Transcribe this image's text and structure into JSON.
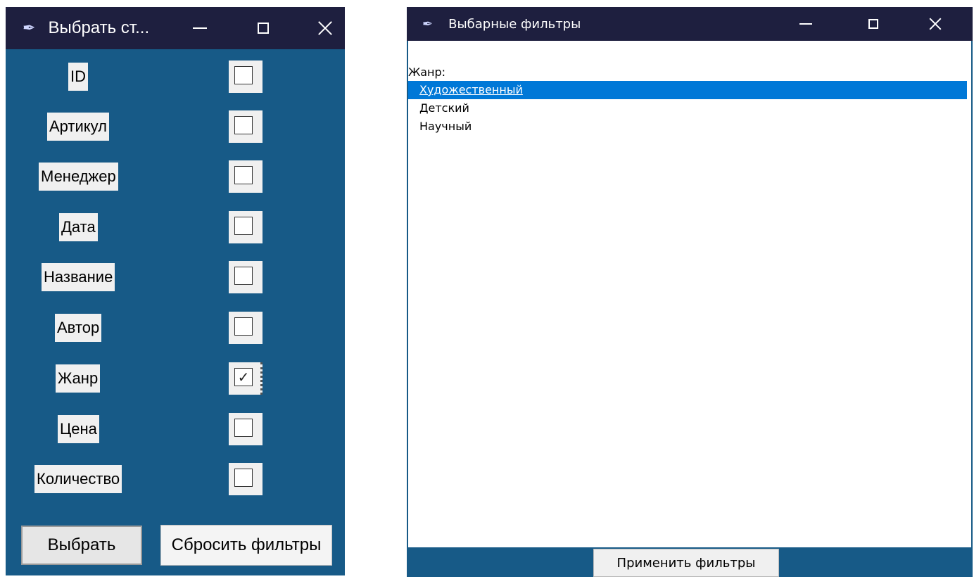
{
  "left_window": {
    "title": "Выбрать ст...",
    "fields": [
      {
        "label": "ID",
        "checked": false
      },
      {
        "label": "Артикул",
        "checked": false
      },
      {
        "label": "Менеджер",
        "checked": false
      },
      {
        "label": "Дата",
        "checked": false
      },
      {
        "label": "Название",
        "checked": false
      },
      {
        "label": "Автор",
        "checked": false
      },
      {
        "label": "Жанр",
        "checked": true
      },
      {
        "label": "Цена",
        "checked": false
      },
      {
        "label": "Количество",
        "checked": false
      }
    ],
    "select_button": "Выбрать",
    "reset_button": "Сбросить фильтры"
  },
  "right_window": {
    "title": "Выбарные фильтры",
    "genre_label": "Жанр:",
    "genres": [
      {
        "label": "Художественный",
        "selected": true
      },
      {
        "label": "Детский",
        "selected": false
      },
      {
        "label": "Научный",
        "selected": false
      }
    ],
    "apply_button": "Применить фильтры"
  },
  "colors": {
    "titlebar": "#1e1f3f",
    "window_bg": "#175a87",
    "selection": "#0078d7",
    "widget_bg": "#f0f0f0"
  },
  "icons": {
    "app": "feather-icon",
    "minimize": "minimize-icon",
    "maximize": "maximize-icon",
    "close": "close-icon",
    "check": "checkmark-icon"
  }
}
